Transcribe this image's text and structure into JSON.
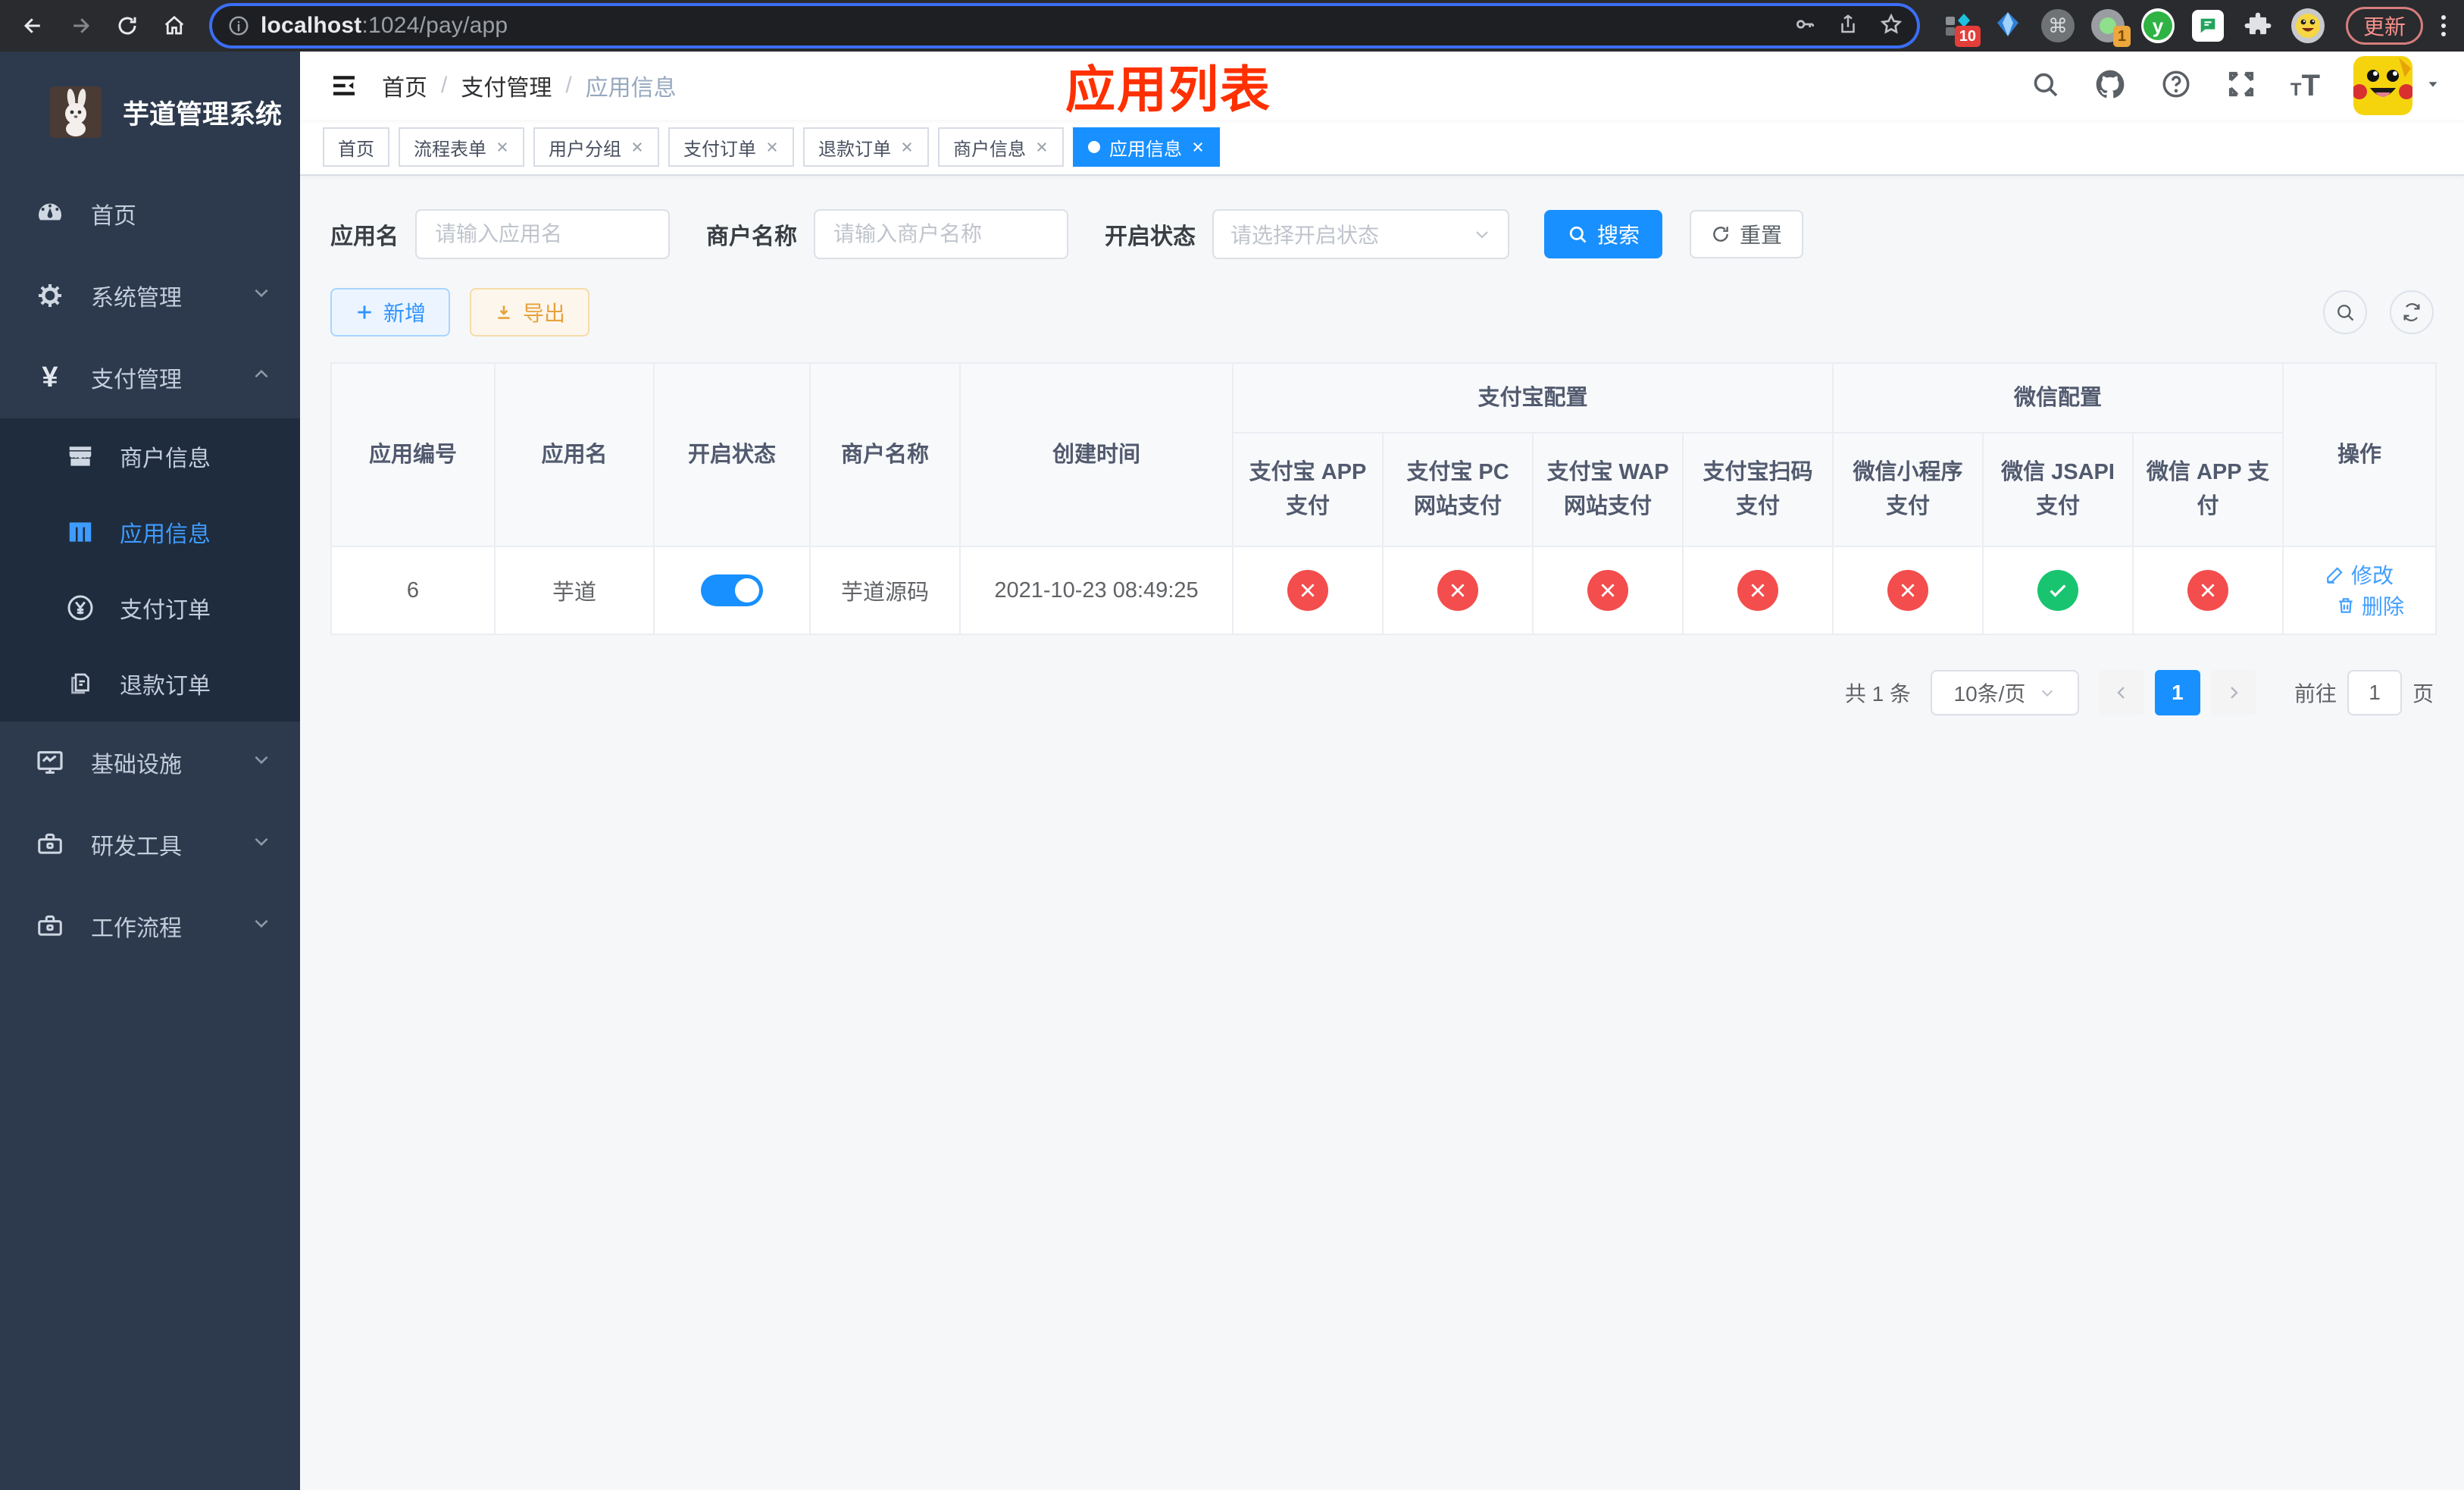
{
  "browser": {
    "url": {
      "host": "localhost",
      "rest": ":1024/pay/app"
    },
    "extensions": {
      "badge_a": "10",
      "badge_b": "1",
      "command_glyph": "⌘",
      "y_glyph": "y"
    },
    "update_label": "更新"
  },
  "sidebar": {
    "title": "芋道管理系统",
    "items": [
      {
        "label": "首页"
      },
      {
        "label": "系统管理"
      },
      {
        "label": "支付管理"
      },
      {
        "label": "基础设施"
      },
      {
        "label": "研发工具"
      },
      {
        "label": "工作流程"
      }
    ],
    "submenu": [
      {
        "label": "商户信息"
      },
      {
        "label": "应用信息"
      },
      {
        "label": "支付订单"
      },
      {
        "label": "退款订单"
      }
    ]
  },
  "header": {
    "breadcrumb": {
      "separator": "/",
      "items": [
        "首页",
        "支付管理",
        "应用信息"
      ]
    },
    "annotation": "应用列表"
  },
  "tabs": [
    {
      "label": "首页"
    },
    {
      "label": "流程表单"
    },
    {
      "label": "用户分组"
    },
    {
      "label": "支付订单"
    },
    {
      "label": "退款订单"
    },
    {
      "label": "商户信息"
    },
    {
      "label": "应用信息"
    }
  ],
  "filters": {
    "app_name": {
      "label": "应用名",
      "placeholder": "请输入应用名"
    },
    "merchant_name": {
      "label": "商户名称",
      "placeholder": "请输入商户名称"
    },
    "status": {
      "label": "开启状态",
      "placeholder": "请选择开启状态"
    },
    "search_label": "搜索",
    "reset_label": "重置"
  },
  "toolbar": {
    "add_label": "新增",
    "export_label": "导出"
  },
  "table": {
    "groups": [
      "支付宝配置",
      "微信配置"
    ],
    "columns": [
      "应用编号",
      "应用名",
      "开启状态",
      "商户名称",
      "创建时间",
      "支付宝 APP 支付",
      "支付宝 PC 网站支付",
      "支付宝 WAP 网站支付",
      "支付宝扫码支付",
      "微信小程序支付",
      "微信 JSAPI 支付",
      "微信 APP 支付",
      "操作"
    ],
    "rows": [
      {
        "id": "6",
        "name": "芋道",
        "enabled": true,
        "merchant": "芋道源码",
        "created": "2021-10-23 08:49:25",
        "statuses": [
          {
            "ok": false
          },
          {
            "ok": false
          },
          {
            "ok": false
          },
          {
            "ok": false
          },
          {
            "ok": false
          },
          {
            "ok": true
          },
          {
            "ok": false
          }
        ],
        "actions": {
          "edit": "修改",
          "delete": "删除"
        }
      }
    ]
  },
  "pagination": {
    "total": "共 1 条",
    "per_page": "10条/页",
    "page": "1",
    "goto_prefix": "前往",
    "goto_value": "1",
    "goto_suffix": "页"
  },
  "colors": {
    "accent": "#1890ff",
    "success": "#18c46f",
    "danger": "#f34d4d",
    "annotation": "#ff3000",
    "sidebar_bg": "#2d3a4d",
    "submenu_bg": "#1f2c3d"
  }
}
